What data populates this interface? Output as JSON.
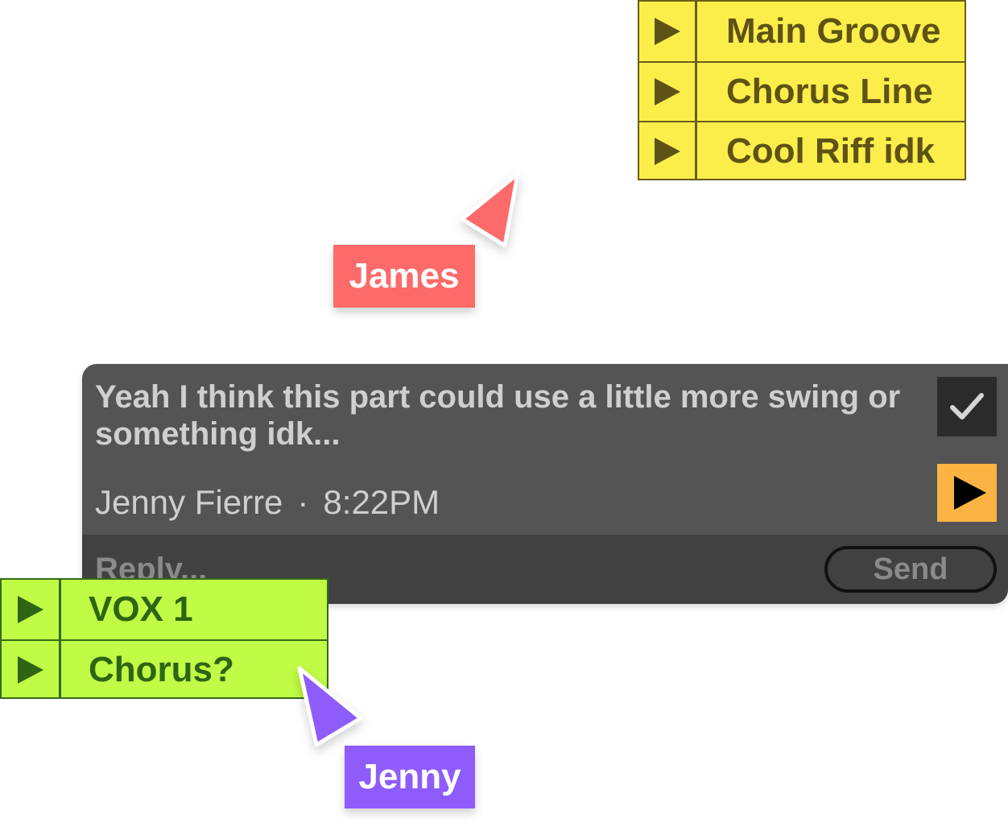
{
  "clip_lists": {
    "yellow": {
      "color": "#fbee4a",
      "items": [
        {
          "label": "Main Groove",
          "icon": "play-icon"
        },
        {
          "label": "Chorus Line",
          "icon": "play-icon"
        },
        {
          "label": "Cool Riff idk",
          "icon": "play-icon"
        }
      ]
    },
    "green": {
      "color": "#c0fb45",
      "items": [
        {
          "label": "VOX 1",
          "icon": "play-icon"
        },
        {
          "label": "Chorus?",
          "icon": "play-icon"
        }
      ]
    }
  },
  "cursors": {
    "james": {
      "name": "James",
      "color": "#fd6a6a"
    },
    "jenny": {
      "name": "Jenny",
      "color": "#8e5cfb"
    }
  },
  "comment": {
    "text": "Yeah I think this part could use a little more swing or something idk...",
    "author": "Jenny Fierre",
    "separator": "·",
    "time": "8:22PM",
    "resolve_icon": "checkmark-icon",
    "play_icon": "play-icon",
    "play_color": "#fbb444",
    "reply_placeholder": "Reply...",
    "send_label": "Send"
  }
}
